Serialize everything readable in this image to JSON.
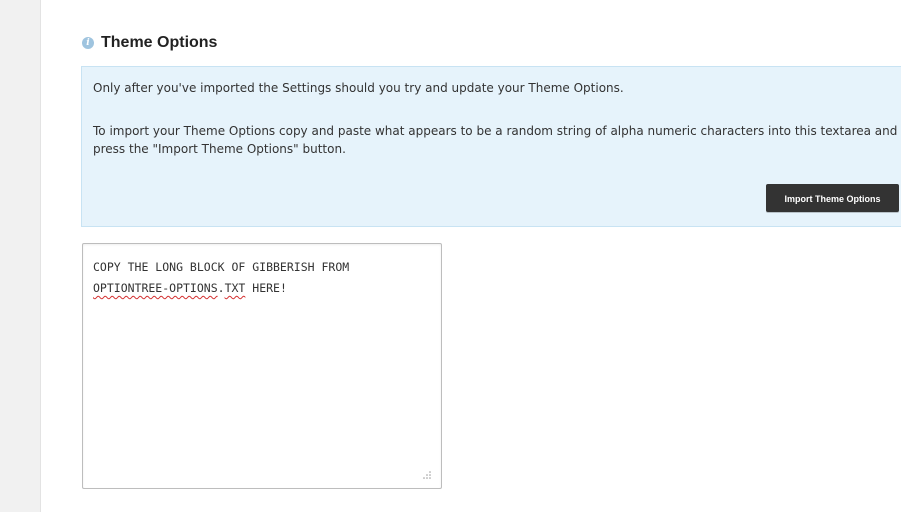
{
  "section": {
    "title": "Theme Options",
    "icon": "info-icon"
  },
  "info": {
    "paragraph1": "Only after you've imported the Settings should you try and update your Theme Options.",
    "paragraph2": "To import your Theme Options copy and paste what appears to be a random string of alpha numeric characters into this textarea and press the \"Import Theme Options\" button."
  },
  "import_button": {
    "label": "Import Theme Options"
  },
  "textarea": {
    "line1": "COPY THE LONG BLOCK OF GIBBERISH FROM",
    "line2_misspelled_a": "OPTIONTREE-OPTIONS",
    "line2_sep": ".",
    "line2_misspelled_b": "TXT",
    "line2_rest": " HERE!"
  },
  "colors": {
    "info_bg": "#e6f3fb",
    "button_bg": "#333333",
    "spellcheck": "#d32f2f"
  }
}
